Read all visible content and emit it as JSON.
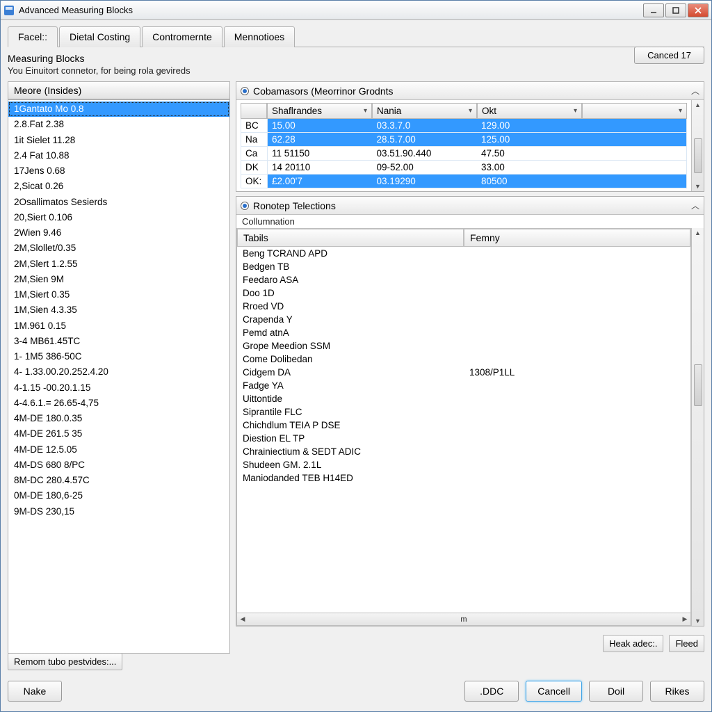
{
  "window": {
    "title": "Advanced Measuring Blocks"
  },
  "tabs": [
    {
      "label": "Facel::",
      "active": true
    },
    {
      "label": "Dietal Costing",
      "active": false
    },
    {
      "label": "Contromernte",
      "active": false
    },
    {
      "label": "Mennotioes",
      "active": false
    }
  ],
  "cancel_top": "Canced 17",
  "fieldset": {
    "title": "Measuring Blocks",
    "subtitle": "You Einuitort connetor, for being rola gevireds"
  },
  "left_list": {
    "header": "Meore (Insides)",
    "items": [
      "1Gantato Mo 0.8",
      "2.8.Fat 2.38",
      "1it Sielet 11.28",
      "2.4 Fat 10.88",
      "17Jens 0.68",
      "2,Sicat 0.26",
      "2Osallimatos Sesierds",
      "20,Siert 0.106",
      "2Wien 9.46",
      "2M,Slollet/0.35",
      "2M,Slert 1.2.55",
      "2M,Sien 9M",
      "1M,Siert 0.35",
      "1M,Sien 4.3.35",
      "1M.961 0.15",
      "3-4 MB61.45TC",
      "1- 1M5 386-50C",
      "4- 1.33.00.20.252.4.20",
      "4-1.15 -00.20.1.15",
      "4-4.6.1.= 26.65-4,75",
      "4M-DE 180.0.35",
      "4M-DE 261.5 35",
      "4M-DE 12.5.05",
      "4M-DS 680 8/PC",
      "8M-DC 280.4.57C",
      "0M-DE 180,6-25",
      "9M-DS 230,15"
    ],
    "selected_index": 0
  },
  "top_grid": {
    "title": "Cobamasors (Meorrinor Grodnts",
    "columns": [
      "Shaflrandes",
      "Nania",
      "Okt",
      ""
    ],
    "rows": [
      {
        "label": "BC",
        "c1": "15.00",
        "c2": "03.3.7.0",
        "c3": "129.00",
        "sel": true
      },
      {
        "label": "Na",
        "c1": "62.28",
        "c2": "28.5.7.00",
        "c3": "125.00",
        "sel": true
      },
      {
        "label": "Ca",
        "c1": "11 51150",
        "c2": "03.51.90.440",
        "c3": "47.50",
        "sel": false
      },
      {
        "label": "DK",
        "c1": "14 20110",
        "c2": "09-52.00",
        "c3": "33.00",
        "sel": false
      },
      {
        "label": "OK:",
        "c1": "£2.00'7",
        "c2": "03.19290",
        "c3": "80500",
        "sel": true
      }
    ]
  },
  "bottom_table": {
    "title": "Ronotep Telections",
    "subtitle": "Collumnation",
    "columns": [
      "Tabils",
      "Femny"
    ],
    "rows": [
      {
        "c1": "Beng TCRAND APD",
        "c2": ""
      },
      {
        "c1": "Bedgen TB",
        "c2": ""
      },
      {
        "c1": "Feedaro ASA",
        "c2": ""
      },
      {
        "c1": "Doo 1D",
        "c2": ""
      },
      {
        "c1": "Rroed VD",
        "c2": ""
      },
      {
        "c1": "Crapenda Y",
        "c2": ""
      },
      {
        "c1": "Pemd atnA",
        "c2": ""
      },
      {
        "c1": "Grope Meedion SSM",
        "c2": ""
      },
      {
        "c1": "Come Dolibedan",
        "c2": ""
      },
      {
        "c1": "Cidgem DA",
        "c2": "1308/P1LL"
      },
      {
        "c1": "Fadge YA",
        "c2": ""
      },
      {
        "c1": "Uittontide",
        "c2": ""
      },
      {
        "c1": "Siprantile FLC",
        "c2": ""
      },
      {
        "c1": "Chichdlum TEIA P DSE",
        "c2": ""
      },
      {
        "c1": "Diestion EL TP",
        "c2": ""
      },
      {
        "c1": "Chrainiectium & SEDT ADIC",
        "c2": ""
      },
      {
        "c1": "Shudeen GM. 2.1L",
        "c2": ""
      },
      {
        "c1": "Maniodanded TEB H14ED",
        "c2": ""
      }
    ],
    "hscroll_label": "m"
  },
  "bottom_link_left": "Remom tubo pestvides:...",
  "bottom_right_buttons": [
    "Heak adec:.",
    "Fleed"
  ],
  "footer_buttons": {
    "left": "Nake",
    "right": [
      ".DDC",
      "Cancell",
      "Doil",
      "Rikes"
    ],
    "focused_index": 1
  }
}
